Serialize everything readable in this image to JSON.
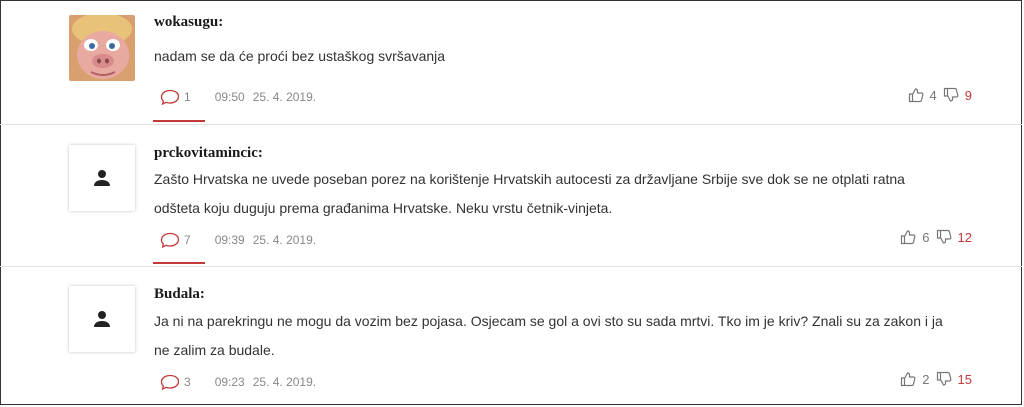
{
  "comments": [
    {
      "username": "wokasugu:",
      "text": "nadam se da će proći bez ustaškog svršavanja",
      "replies": "1",
      "time": "09:50",
      "date": "25. 4. 2019.",
      "likes": "4",
      "dislikes": "9",
      "avatar": "puppet-avatar"
    },
    {
      "username": "prckovitamincic:",
      "text": "Zašto Hrvatska ne uvede poseban porez na korištenje Hrvatskih autocesti za državljane Srbije sve dok se ne otplati ratna odšteta koju duguju prema građanima Hrvatske. Neku vrstu četnik-vinjeta.",
      "replies": "7",
      "time": "09:39",
      "date": "25. 4. 2019.",
      "likes": "6",
      "dislikes": "12",
      "avatar": "default-user-icon"
    },
    {
      "username": "Budala:",
      "text": "Ja ni na parekringu ne mogu da vozim bez pojasa. Osjecam se gol a ovi sto su sada mrtvi. Tko im je kriv? Znali su za zakon i ja ne zalim za budale.",
      "replies": "3",
      "time": "09:23",
      "date": "25. 4. 2019.",
      "likes": "2",
      "dislikes": "15",
      "avatar": "default-user-icon"
    }
  ],
  "colors": {
    "accent": "#c23a3a",
    "meta": "#888888"
  }
}
